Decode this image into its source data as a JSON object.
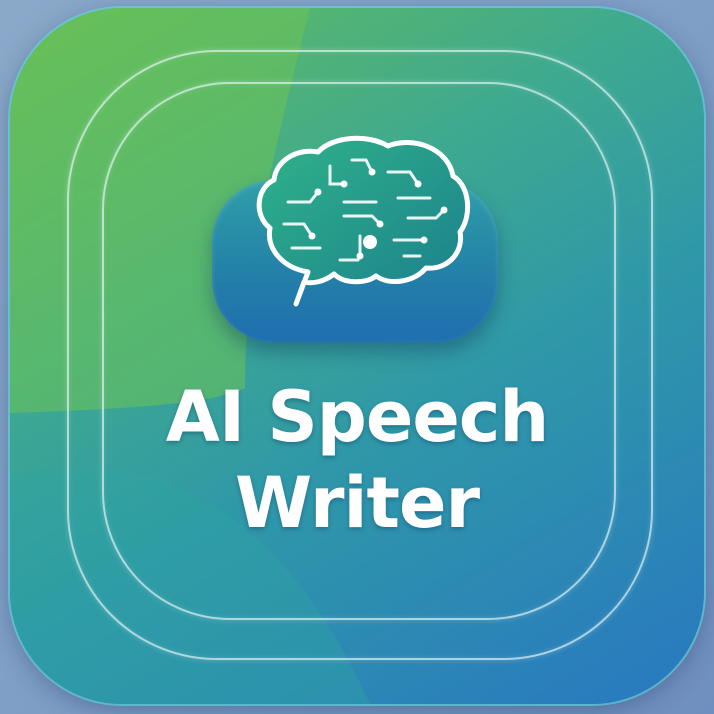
{
  "title": {
    "line1": "AI Speech",
    "line2": "Writer"
  },
  "icons": {
    "main": "brain-speech-bubble-icon"
  },
  "colors": {
    "green": "#66bd59",
    "teal": "#3faa8e",
    "blue": "#2878c0",
    "text": "#ffffff"
  }
}
